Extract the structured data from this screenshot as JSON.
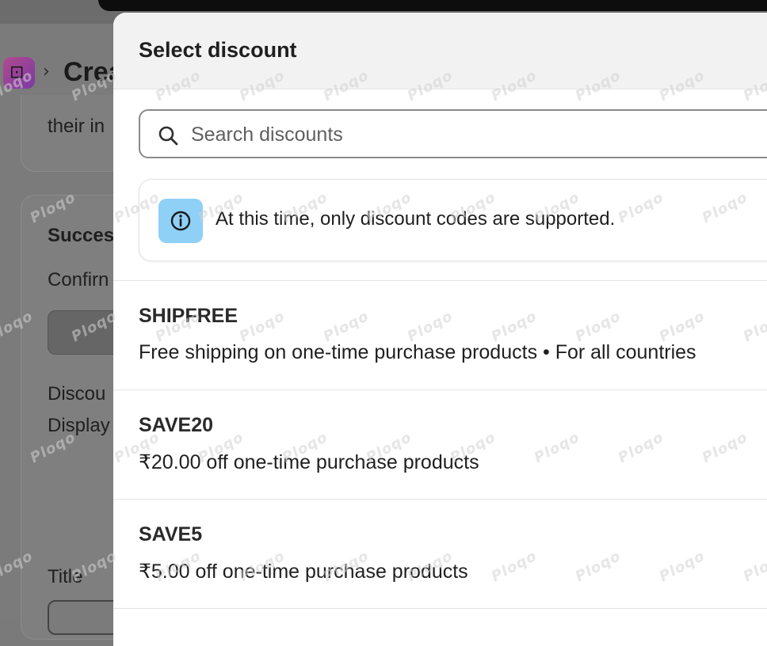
{
  "background": {
    "breadcrumb_title": "Crea",
    "card1_text": "their in",
    "card2_heading": "Succes",
    "card2_text": "Confirn",
    "discount_label": "Discou",
    "display_label": "Display",
    "title_label": "Title"
  },
  "modal": {
    "title": "Select discount",
    "search": {
      "placeholder": "Search discounts"
    },
    "banner": {
      "text": "At this time, only discount codes are supported."
    },
    "discounts": [
      {
        "code": "SHIPFREE",
        "description": "Free shipping on one-time purchase products • For all countries"
      },
      {
        "code": "SAVE20",
        "description": "₹20.00 off one-time purchase products"
      },
      {
        "code": "SAVE5",
        "description": "₹5.00 off one-time purchase products"
      }
    ]
  },
  "watermark": {
    "text": "Ploqo"
  },
  "colors": {
    "banner_icon_bg": "#8fd0f7",
    "overlay": "#7b7b7b"
  }
}
